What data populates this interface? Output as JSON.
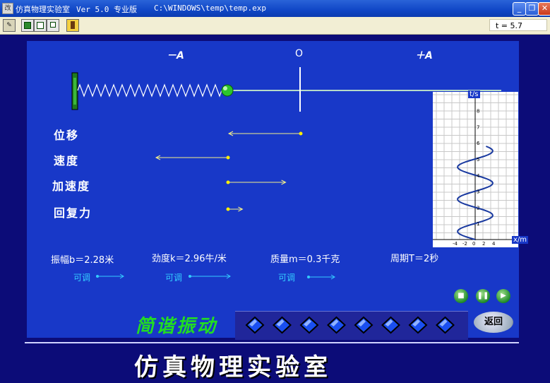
{
  "window": {
    "title": "仿真物理实验室",
    "version": "Ver 5.0 专业版",
    "path": "C:\\WINDOWS\\temp\\temp.exp",
    "icon_text": "改",
    "buttons": {
      "minimize": "_",
      "restore": "❐",
      "close": "✕"
    }
  },
  "toolbar": {
    "tool_icons": [
      "stop-icon",
      "frame-icon",
      "frame-small-icon",
      "exit-door-icon"
    ],
    "time_readout": "t = 5.7"
  },
  "stage": {
    "axis_labels": {
      "neg": "－A",
      "zero": "O",
      "pos": "＋A"
    },
    "quantities": [
      {
        "label": "位移",
        "value": 1.0,
        "direction": "left"
      },
      {
        "label": "速度",
        "value": -1.0,
        "direction": "left"
      },
      {
        "label": "加速度",
        "value": 0.8,
        "direction": "right"
      },
      {
        "label": "回复力",
        "value": 0.2,
        "direction": "right"
      }
    ],
    "params": {
      "amplitude": "振幅b＝2.28米",
      "stiffness": "劲度k＝2.96牛/米",
      "mass": "质量m＝0.3千克",
      "period": "周期T＝2秒"
    },
    "adjust_label": "可调"
  },
  "graph": {
    "ylabel": "t/s",
    "xlabel": "x/m",
    "y_ticks": [
      "1",
      "2",
      "3",
      "4",
      "5",
      "6",
      "7",
      "8"
    ],
    "x_ticks": [
      "-4",
      "-2",
      "0",
      "2",
      "4"
    ]
  },
  "controls": {
    "return_label": "返回"
  },
  "banner": {
    "subtitle": "简谐振动",
    "main_title": "仿真物理实验室"
  },
  "colors": {
    "stage": "#1838c8",
    "background": "#0c0c78",
    "accent_green": "#22dd22",
    "vector_yellow": "#f5f08a"
  }
}
